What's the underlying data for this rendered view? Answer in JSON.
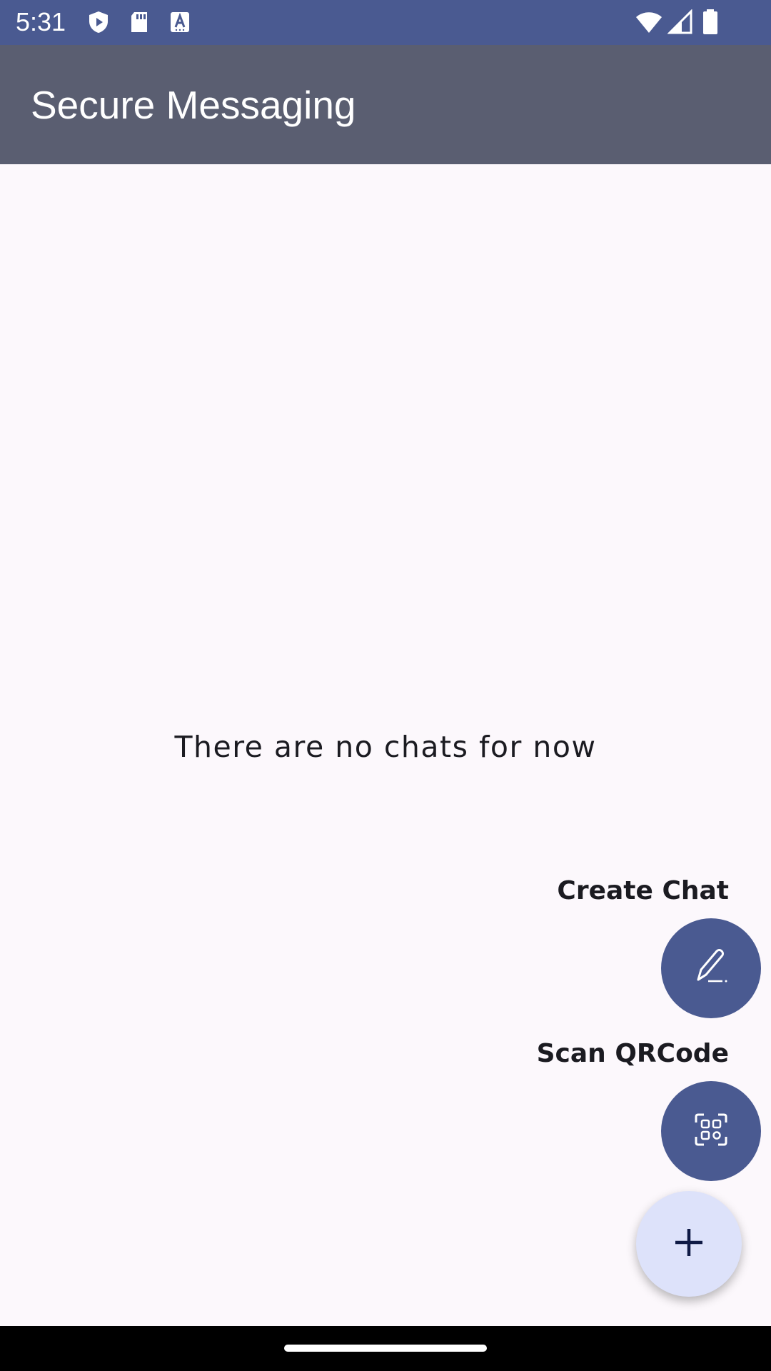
{
  "status_bar": {
    "time": "5:31",
    "left_icons": [
      "shield-icon",
      "sd-card-icon",
      "text-a-icon"
    ],
    "right_icons": [
      "wifi-icon",
      "signal-icon",
      "battery-icon"
    ]
  },
  "app_bar": {
    "title": "Secure Messaging"
  },
  "main": {
    "empty_message": "There are no chats for now"
  },
  "fab_menu": {
    "create_chat_label": "Create Chat",
    "create_chat_icon": "pen-icon",
    "scan_qr_label": "Scan QRCode",
    "scan_qr_icon": "qr-scan-icon",
    "main_icon": "plus-icon"
  },
  "colors": {
    "status_bar": "#4a5a91",
    "app_bar": "#5a5e71",
    "background": "#fcf8fc",
    "fab_secondary": "#4a5a91",
    "fab_primary": "#dde2fa",
    "fab_primary_icon": "#0f1a45"
  }
}
